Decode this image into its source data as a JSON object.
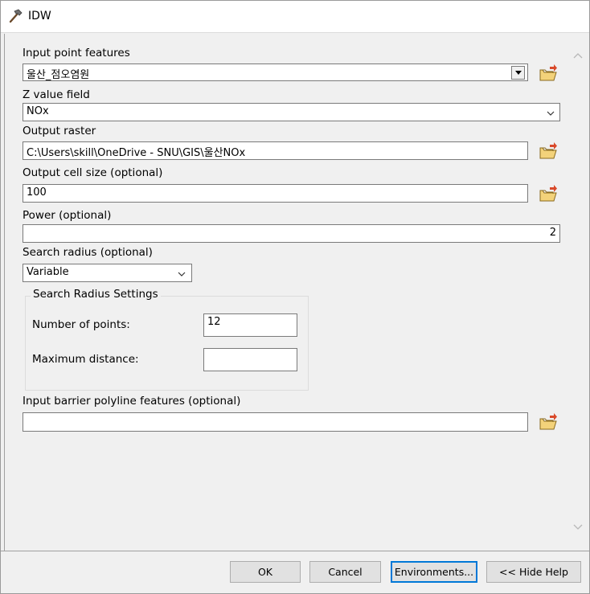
{
  "window": {
    "title": "IDW"
  },
  "form": {
    "input_point_features": {
      "label": "Input point features",
      "value": "울산_점오염원"
    },
    "z_value_field": {
      "label": "Z value field",
      "value": "NOx"
    },
    "output_raster": {
      "label": "Output raster",
      "value": "C:\\Users\\skill\\OneDrive - SNU\\GIS\\울산NOx"
    },
    "output_cell_size": {
      "label": "Output cell size (optional)",
      "value": "100"
    },
    "power": {
      "label": "Power (optional)",
      "value": "2"
    },
    "search_radius": {
      "label": "Search radius (optional)",
      "value": "Variable"
    },
    "search_radius_settings": {
      "title": "Search Radius Settings",
      "number_of_points": {
        "label": "Number of points:",
        "value": "12"
      },
      "maximum_distance": {
        "label": "Maximum distance:",
        "value": ""
      }
    },
    "input_barrier": {
      "label": "Input barrier polyline features (optional)",
      "value": ""
    }
  },
  "buttons": {
    "ok": "OK",
    "cancel": "Cancel",
    "environments": "Environments...",
    "hide_help": "<< Hide Help"
  },
  "icons": {
    "title": "hammer-icon",
    "browse": "open-folder-icon"
  }
}
